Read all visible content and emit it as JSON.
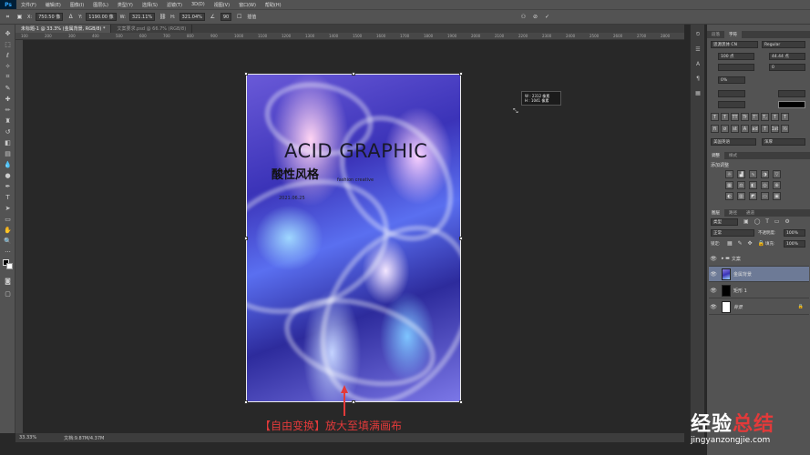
{
  "app": {
    "logo": "Ps"
  },
  "menu": [
    "文件(F)",
    "编辑(E)",
    "图像(I)",
    "图层(L)",
    "类型(Y)",
    "选择(S)",
    "滤镜(T)",
    "3D(D)",
    "视图(V)",
    "窗口(W)",
    "帮助(H)"
  ],
  "options": {
    "x_label": "X:",
    "x_value": "750.50 像",
    "y_label": "Y:",
    "y_value": "1190.00 像",
    "w_label": "W:",
    "w_value": "321.11%",
    "h_label": "H:",
    "h_value": "321.04%",
    "angle_value": "90",
    "interp_label": "插值",
    "cancel_icon": "cancel-icon",
    "commit_icon": "check-icon"
  },
  "tabs": [
    {
      "label": "未标题-1 @ 33.3% (金属背景, RGB/8) *",
      "active": true
    },
    {
      "label": "文案要求.psd @ 66.7% (RGB/8)",
      "active": false
    }
  ],
  "ruler_ticks": [
    "100",
    "200",
    "300",
    "400",
    "500",
    "600",
    "700",
    "800",
    "900",
    "1000",
    "1100",
    "1200",
    "1300",
    "1400",
    "1500",
    "1600",
    "1700",
    "1800",
    "1900",
    "2000",
    "2100",
    "2200",
    "2300",
    "2400",
    "2500",
    "2600",
    "2700",
    "2800"
  ],
  "canvas": {
    "title": "ACID GRAPHIC",
    "subtitle": "酸性风格",
    "tagline": "fashion creative",
    "date": "2021.06.25"
  },
  "size_tooltip": {
    "w": "W : 2312 像素",
    "h": "H : 1041 像素"
  },
  "caption": "【自由变换】放大至填满画布",
  "status": {
    "zoom": "33.33%",
    "doc": "文档:9.87M/4.37M"
  },
  "character_panel": {
    "tabs": [
      "段落",
      "字符"
    ],
    "font": "思源黑体 CN",
    "style": "Regular",
    "size": "100 点",
    "leading": "44.44 点",
    "tracking": "0",
    "scale": "0%",
    "lang": "美国英语",
    "aa": "浑厚",
    "styles_buttons": [
      "T",
      "T",
      "TT",
      "Tr",
      "T'",
      "T,",
      "T",
      "T"
    ],
    "color_hex": "#000000"
  },
  "adjustments_panel": {
    "tabs": [
      "调整",
      "样式"
    ],
    "label": "添加调整"
  },
  "layers_panel": {
    "tabs": [
      "图层",
      "路径",
      "通道"
    ],
    "kind": "类型",
    "blend": "正常",
    "opacity_label": "不透明度:",
    "opacity": "100%",
    "lock_label": "锁定:",
    "fill_label": "填充:",
    "fill": "100%",
    "layers": [
      {
        "name": "文案",
        "type": "group",
        "selected": false
      },
      {
        "name": "金属背景",
        "type": "smart",
        "selected": true
      },
      {
        "name": "矩形 1",
        "type": "shape",
        "selected": false
      },
      {
        "name": "背景",
        "type": "background",
        "selected": false
      }
    ]
  },
  "watermark": {
    "main_a": "经验",
    "main_b": "总结",
    "url": "jingyanzongjie.com"
  }
}
